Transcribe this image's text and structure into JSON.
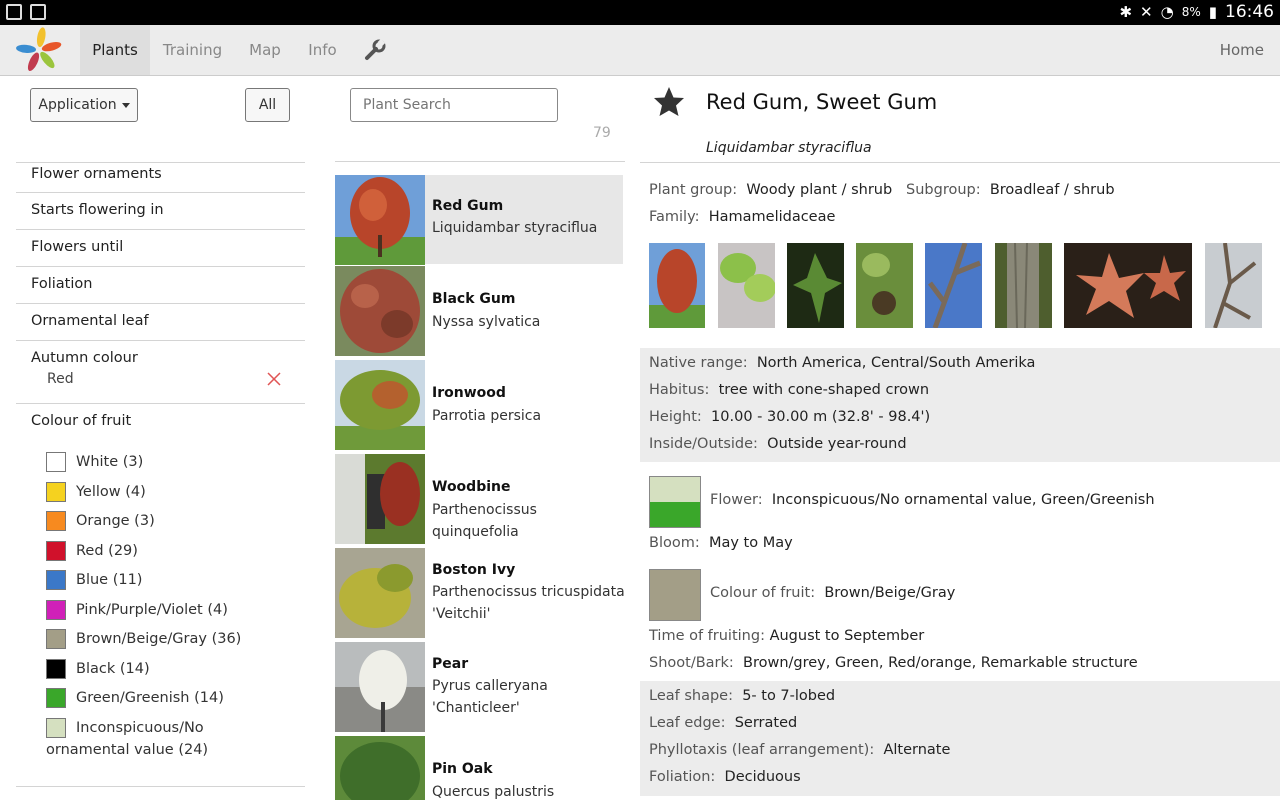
{
  "status": {
    "battery": "8%",
    "time": "16:46"
  },
  "nav": {
    "tabs": [
      "Plants",
      "Training",
      "Map",
      "Info"
    ],
    "home": "Home"
  },
  "filters": {
    "application_label": "Application",
    "all_label": "All",
    "items": [
      "Flower ornaments",
      "Starts flowering in",
      "Flowers until",
      "Foliation",
      "Ornamental leaf",
      "Autumn colour",
      "Colour of fruit"
    ],
    "autumn_selected": "Red",
    "fruit_colours": [
      {
        "label": "White (3)",
        "color": "#ffffff"
      },
      {
        "label": "Yellow (4)",
        "color": "#f5d21f"
      },
      {
        "label": "Orange (3)",
        "color": "#f78a1f"
      },
      {
        "label": "Red (29)",
        "color": "#d0112b"
      },
      {
        "label": "Blue (11)",
        "color": "#3b78c8"
      },
      {
        "label": "Pink/Purple/Violet (4)",
        "color": "#d020b8"
      },
      {
        "label": "Brown/Beige/Gray (36)",
        "color": "#a39e87"
      },
      {
        "label": "Black (14)",
        "color": "#000000"
      },
      {
        "label": "Green/Greenish (14)",
        "color": "#3aa72a"
      },
      {
        "label": "Inconspicuous/No",
        "label2": "ornamental value (24)",
        "color": "#d5e0c0"
      }
    ]
  },
  "search": {
    "placeholder": "Plant Search",
    "count": "79"
  },
  "plants": [
    {
      "name": "Red Gum",
      "sci": "Liquidambar styraciflua"
    },
    {
      "name": "Black Gum",
      "sci": "Nyssa sylvatica"
    },
    {
      "name": "Ironwood",
      "sci": "Parrotia persica"
    },
    {
      "name": "Woodbine",
      "sci": "Parthenocissus quinquefolia"
    },
    {
      "name": "Boston Ivy",
      "sci": "Parthenocissus tricuspidata 'Veitchii'"
    },
    {
      "name": "Pear",
      "sci": "Pyrus calleryana 'Chanticleer'"
    },
    {
      "name": "Pin Oak",
      "sci": "Quercus palustris"
    }
  ],
  "detail": {
    "title": "Red Gum, Sweet Gum",
    "latin": "Liquidambar styraciflua",
    "plant_group_k": "Plant group:",
    "plant_group_v": "Woody plant / shrub",
    "subgroup_k": "Subgroup:",
    "subgroup_v": "Broadleaf / shrub",
    "family_k": "Family:",
    "family_v": "Hamamelidaceae",
    "native_k": "Native range:",
    "native_v": "North America, Central/South Amerika",
    "habitus_k": "Habitus:",
    "habitus_v": "tree with cone-shaped crown",
    "height_k": "Height:",
    "height_v": "10.00 - 30.00 m (32.8' - 98.4')",
    "inout_k": "Inside/Outside:",
    "inout_v": "Outside year-round",
    "flower_k": "Flower:",
    "flower_v": "Inconspicuous/No ornamental value, Green/Greenish",
    "bloom_k": "Bloom:",
    "bloom_v": "May to May",
    "fruit_k": "Colour of fruit:",
    "fruit_v": "Brown/Beige/Gray",
    "fruiting_k": "Time of fruiting:",
    "fruiting_v": "August to September",
    "shoot_k": "Shoot/Bark:",
    "shoot_v": "Brown/grey, Green, Red/orange, Remarkable structure",
    "leafshape_k": "Leaf shape:",
    "leafshape_v": "5- to 7-lobed",
    "leafedge_k": "Leaf edge:",
    "leafedge_v": "Serrated",
    "phyllo_k": "Phyllotaxis (leaf arrangement):",
    "phyllo_v": "Alternate",
    "foliation_k": "Foliation:",
    "foliation_v": "Deciduous",
    "flower_colors": [
      "#d5e0c0",
      "#3aa72a"
    ],
    "fruit_color": "#a39e87"
  }
}
